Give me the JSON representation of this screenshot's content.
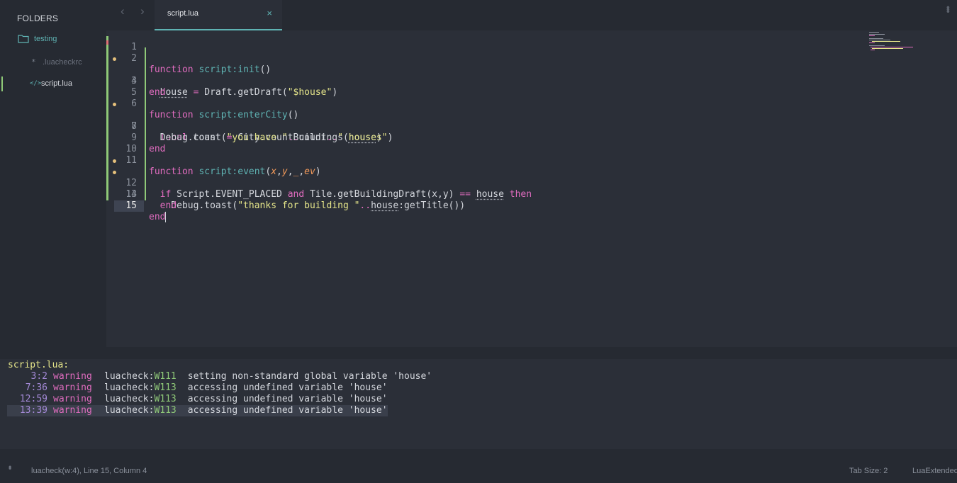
{
  "sidebar": {
    "heading": "FOLDERS",
    "folder": "testing",
    "files": [
      {
        "name": ".luacheckrc",
        "icon": "asterisk-icon"
      },
      {
        "name": "script.lua",
        "icon": "code-icon"
      }
    ]
  },
  "tabs": [
    {
      "title": "script.lua",
      "close": "×"
    }
  ],
  "editor": {
    "line_numbers": [
      "1",
      "2",
      "3",
      "4",
      "5",
      "6",
      "7",
      "8",
      "9",
      "10",
      "11",
      "12",
      "13",
      "14",
      "15"
    ],
    "current_line": 15
  },
  "output": {
    "title": "script.lua:",
    "rows": [
      {
        "loc": "3:2",
        "level": "warning",
        "tool": "luacheck:",
        "code": "W111",
        "message": "setting non-standard global variable 'house'"
      },
      {
        "loc": "7:36",
        "level": "warning",
        "tool": "luacheck:",
        "code": "W113",
        "message": "accessing undefined variable 'house'"
      },
      {
        "loc": "12:59",
        "level": "warning",
        "tool": "luacheck:",
        "code": "W113",
        "message": "accessing undefined variable 'house'"
      },
      {
        "loc": "13:39",
        "level": "warning",
        "tool": "luacheck:",
        "code": "W113",
        "message": "accessing undefined variable 'house'"
      }
    ]
  },
  "status": {
    "left": "luacheck(w:4), Line 15, Column 4",
    "tab_size": "Tab Size: 2",
    "syntax": "LuaExtended"
  },
  "colors": {
    "accent": "#5fb3b3",
    "keyword": "#e06cbf",
    "string": "#e5e58a",
    "modified": "#8fc978",
    "warning_dot": "#e5c07b"
  }
}
